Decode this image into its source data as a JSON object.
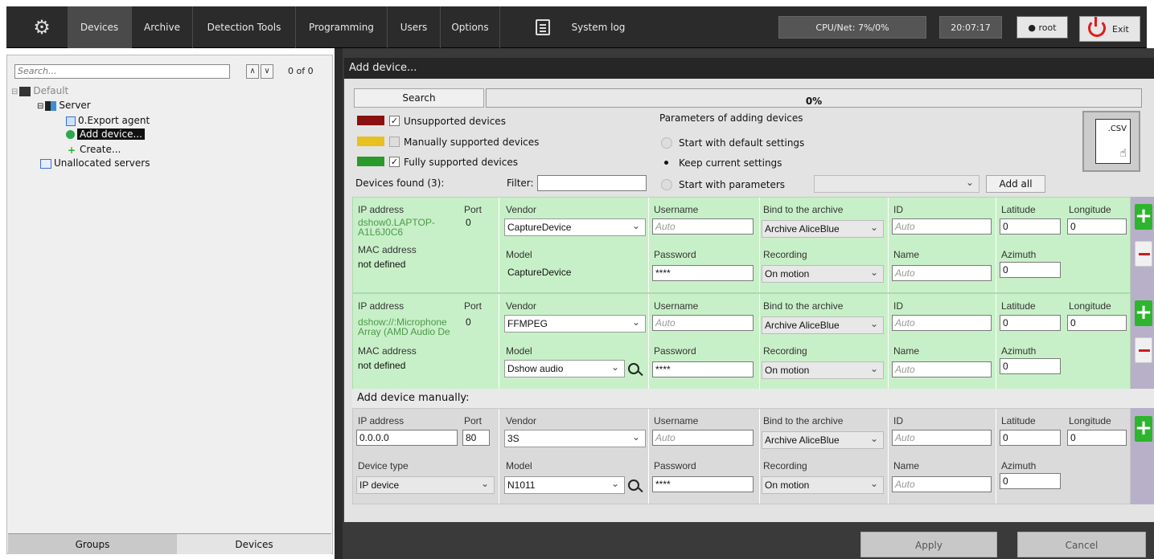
{
  "topbar": {
    "tabs": [
      "Devices",
      "Archive",
      "Detection Tools",
      "Programming",
      "Users",
      "Options"
    ],
    "syslog": "System log",
    "cpu": "CPU/Net: 7%/0%",
    "clock": "20:07:17",
    "user": "root",
    "exit": "Exit"
  },
  "left": {
    "search_placeholder": "Search...",
    "count": "0 of 0",
    "tree": {
      "default": "Default",
      "server": "Server",
      "export": "0.Export agent",
      "add": "Add device...",
      "create": "Create...",
      "unallocated": "Unallocated servers"
    },
    "tabs": {
      "groups": "Groups",
      "devices": "Devices"
    }
  },
  "panel": {
    "title": "Add device...",
    "search_btn": "Search",
    "progress": "0%",
    "legend": {
      "unsupported": "Unsupported devices",
      "manual": "Manually supported devices",
      "full": "Fully supported devices"
    },
    "params_title": "Parameters of adding devices",
    "radio": {
      "default": "Start with default settings",
      "keep": "Keep current settings",
      "params": "Start with parameters"
    },
    "add_all": "Add all",
    "found": "Devices found (3):",
    "filter": "Filter:",
    "csv": ".CSV",
    "manual_title": "Add device manually:"
  },
  "labels": {
    "ip": "IP address",
    "port": "Port",
    "mac": "MAC address",
    "vendor": "Vendor",
    "model": "Model",
    "username": "Username",
    "password": "Password",
    "bind": "Bind to the archive",
    "recording": "Recording",
    "id": "ID",
    "name": "Name",
    "lat": "Latitude",
    "lon": "Longitude",
    "az": "Azimuth",
    "devtype": "Device type"
  },
  "devices": [
    {
      "ip1": "dshow0.LAPTOP-",
      "ip2": "A1L6J0C6",
      "port": "0",
      "mac": "not defined",
      "vendor": "CaptureDevice",
      "model": "CaptureDevice",
      "user_ph": "Auto",
      "pass": "****",
      "archive": "Archive AliceBlue",
      "rec": "On motion",
      "id_ph": "Auto",
      "name_ph": "Auto",
      "lat": "0",
      "lon": "0",
      "az": "0"
    },
    {
      "ip1": "dshow://:Microphone",
      "ip2": "Array (AMD Audio De",
      "port": "0",
      "mac": "not defined",
      "vendor": "FFMPEG",
      "model": "Dshow audio",
      "user_ph": "Auto",
      "pass": "****",
      "archive": "Archive AliceBlue",
      "rec": "On motion",
      "id_ph": "Auto",
      "name_ph": "Auto",
      "lat": "0",
      "lon": "0",
      "az": "0"
    }
  ],
  "manual": {
    "ip": "0.0.0.0",
    "port": "80",
    "devtype": "IP device",
    "vendor": "3S",
    "model": "N1011",
    "user_ph": "Auto",
    "pass": "****",
    "archive": "Archive AliceBlue",
    "rec": "On motion",
    "id_ph": "Auto",
    "name_ph": "Auto",
    "lat": "0",
    "lon": "0",
    "az": "0"
  },
  "footer": {
    "apply": "Apply",
    "cancel": "Cancel"
  }
}
